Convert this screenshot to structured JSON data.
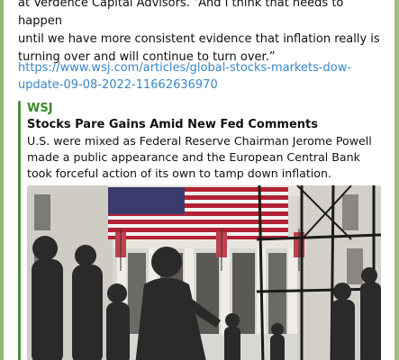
{
  "message": {
    "text_line1": "at Verdence Capital Advisors. “And I think that needs to happen",
    "text_line2": "until we have more consistent evidence that inflation really is",
    "text_line3": "turning over and will continue to turn over.”",
    "link": "https://www.wsj.com/articles/global-stocks-markets-dow-update-09-08-2022-11662636970"
  },
  "preview": {
    "site_name": "WSJ",
    "title": "Stocks Pare Gains Amid New Fed Comments",
    "description": "U.S. were mixed as Federal Reserve Chairman Jerome Powell made a public appearance and the European Central Bank took forceful action of its own to tamp down inflation.",
    "image_icon": "photo-nyse-facade-with-flags"
  },
  "colors": {
    "link": "#3a86c6",
    "accent": "#4a8f3a",
    "chat_background": "#a9c98a"
  }
}
